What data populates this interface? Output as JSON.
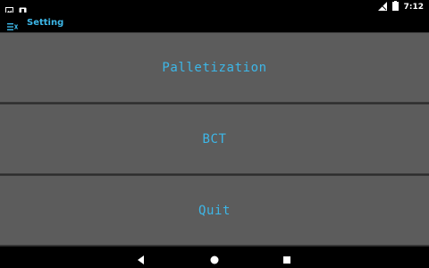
{
  "status_bar": {
    "left_icons": [
      "image-icon",
      "notification-icon"
    ],
    "right_icons": [
      "signal-icon",
      "battery-icon"
    ],
    "time": "7:12"
  },
  "title_bar": {
    "menu_icon": "list-menu-icon",
    "title": "Setting",
    "accent_color": "#3db7e8"
  },
  "menu": {
    "items": [
      {
        "label": "Palletization"
      },
      {
        "label": "BCT"
      },
      {
        "label": "Quit"
      }
    ],
    "button_color": "#5c5c5c",
    "text_color": "#3db7e8"
  },
  "nav_bar": {
    "buttons": [
      "back-icon",
      "home-icon",
      "recent-apps-icon"
    ]
  }
}
